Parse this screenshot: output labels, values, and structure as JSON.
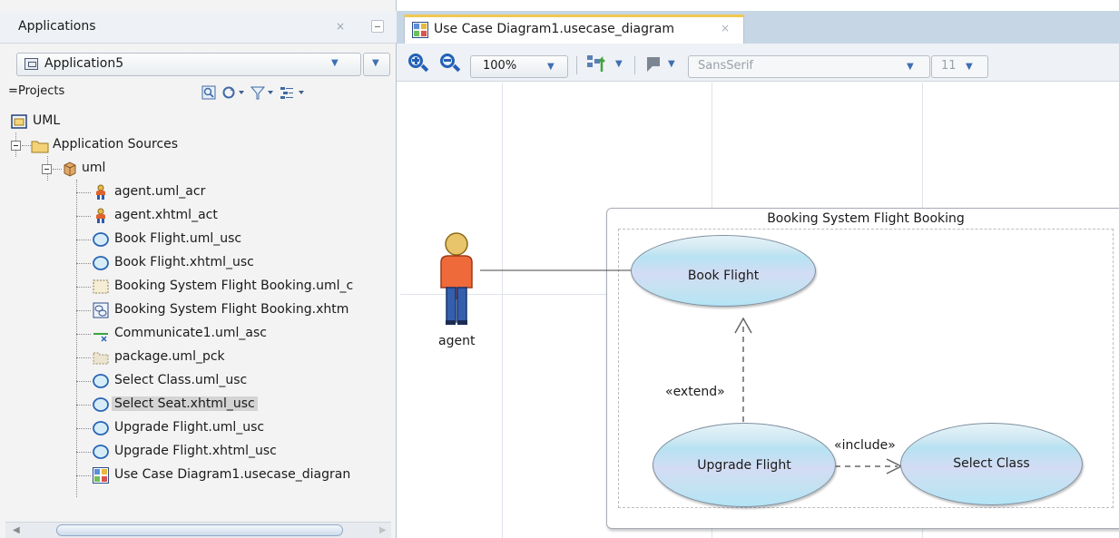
{
  "applications_panel": {
    "title": "Applications",
    "close_glyph": "×",
    "application_selector": {
      "value": "Application5",
      "icon": "application-icon"
    },
    "projects_label": "Projects",
    "projects_toolbar_icons": [
      "search-icon",
      "refresh-icon",
      "filter-icon",
      "options-icon"
    ]
  },
  "tree": {
    "root": {
      "label": "UML",
      "icon": "project-icon"
    },
    "folder": {
      "label": "Application Sources",
      "icon": "folder-icon"
    },
    "package": {
      "label": "uml",
      "icon": "package-icon"
    },
    "items": [
      {
        "label": "agent.uml_acr",
        "icon": "actor-icon"
      },
      {
        "label": "agent.xhtml_act",
        "icon": "actor-icon"
      },
      {
        "label": "Book Flight.uml_usc",
        "icon": "usecase-icon"
      },
      {
        "label": "Book Flight.xhtml_usc",
        "icon": "usecase-icon"
      },
      {
        "label": "Booking System Flight Booking.uml_c",
        "icon": "system-boundary-icon"
      },
      {
        "label": "Booking System Flight Booking.xhtm",
        "icon": "system-xhtml-icon"
      },
      {
        "label": "Communicate1.uml_asc",
        "icon": "association-icon"
      },
      {
        "label": "package.uml_pck",
        "icon": "package-file-icon"
      },
      {
        "label": "Select Class.uml_usc",
        "icon": "usecase-icon"
      },
      {
        "label": "Select Seat.xhtml_usc",
        "icon": "usecase-icon",
        "selected": true
      },
      {
        "label": "Upgrade Flight.uml_usc",
        "icon": "usecase-icon"
      },
      {
        "label": "Upgrade Flight.xhtml_usc",
        "icon": "usecase-icon"
      },
      {
        "label": "Use Case Diagram1.usecase_diagran",
        "icon": "diagram-icon"
      }
    ]
  },
  "editor": {
    "tab_title": "Use Case Diagram1.usecase_diagram",
    "tab_close_glyph": "×",
    "toolbar": {
      "zoom": "100%",
      "font": "SansSerif",
      "font_size": "11"
    }
  },
  "diagram": {
    "actor": {
      "label": "agent"
    },
    "system": {
      "title": "Booking System Flight Booking"
    },
    "use_cases": {
      "book_flight": "Book Flight",
      "upgrade_flight": "Upgrade Flight",
      "select_class": "Select Class"
    },
    "relations": {
      "extend": "«extend»",
      "include": "«include»"
    }
  }
}
